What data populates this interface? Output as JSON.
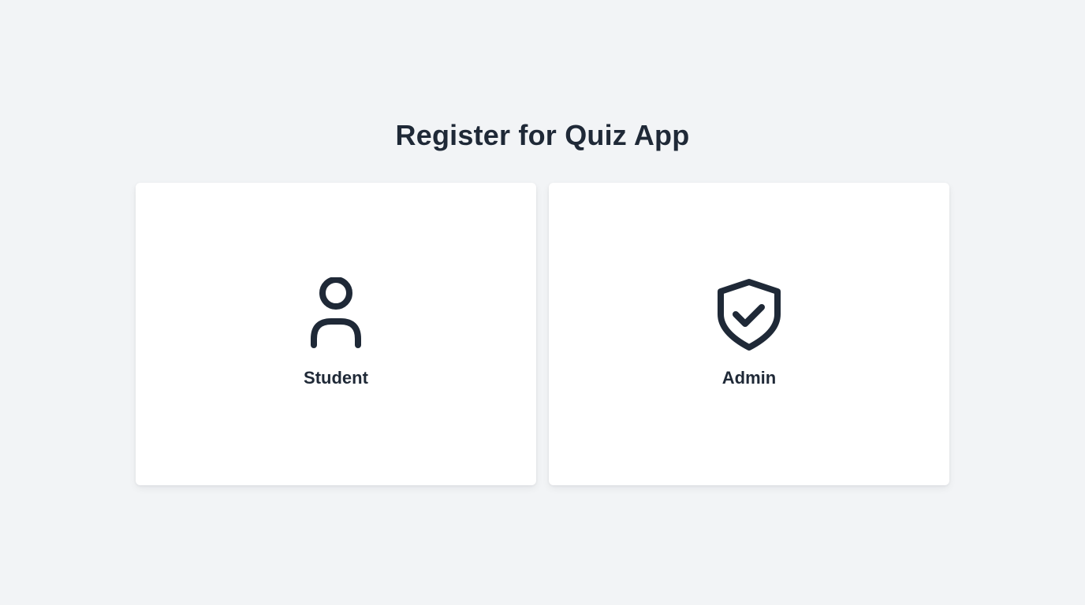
{
  "page": {
    "title": "Register for Quiz App"
  },
  "roles": [
    {
      "label": "Student",
      "icon": "user-icon"
    },
    {
      "label": "Admin",
      "icon": "shield-check-icon"
    }
  ],
  "colors": {
    "background": "#f2f4f6",
    "card": "#ffffff",
    "text": "#1f2937",
    "icon": "#1f2937"
  }
}
